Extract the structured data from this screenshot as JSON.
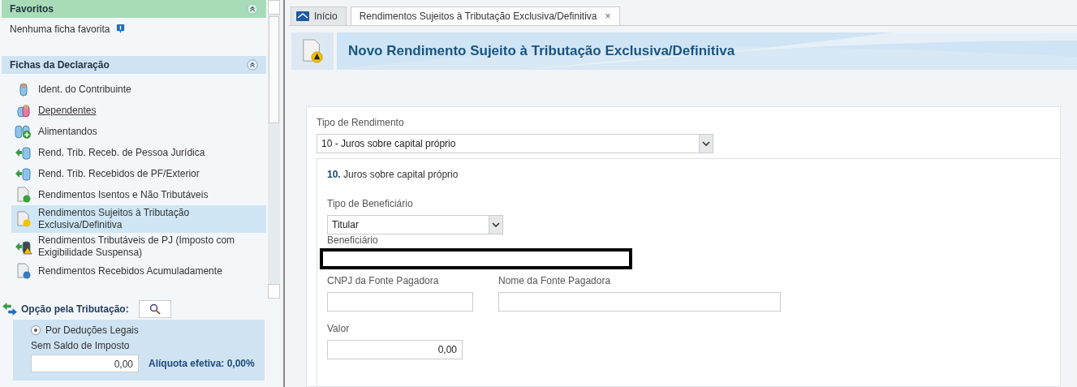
{
  "sidebar": {
    "favorites": {
      "title": "Favoritos",
      "expanded": true,
      "empty_text": "Nenhuma ficha favorita"
    },
    "sheets": {
      "title": "Fichas da Declaração",
      "expanded": true,
      "items": [
        {
          "label": "Ident. do Contribuinte",
          "kind": "person",
          "selected": false,
          "hovered": false
        },
        {
          "label": "Dependentes",
          "kind": "people",
          "selected": false,
          "hovered": true
        },
        {
          "label": "Alimentandos",
          "kind": "people-add",
          "selected": false,
          "hovered": false
        },
        {
          "label": "Rend. Trib. Receb. de Pessoa Jurídica",
          "kind": "arrow-person",
          "selected": false,
          "hovered": false
        },
        {
          "label": "Rend. Trib. Recebidos de PF/Exterior",
          "kind": "arrow-person",
          "selected": false,
          "hovered": false
        },
        {
          "label": "Rendimentos Isentos e Não Tributáveis",
          "kind": "doc-check",
          "selected": false,
          "hovered": false
        },
        {
          "label": "Rendimentos Sujeitos à Tributação Exclusiva/Definitiva",
          "kind": "doc-warning",
          "selected": true,
          "hovered": false
        },
        {
          "label": "Rendimentos Tributáveis de PJ (Imposto com Exigibilidade Suspensa)",
          "kind": "arrow-warning",
          "selected": false,
          "hovered": false
        },
        {
          "label": "Rendimentos Recebidos Acumuladamente",
          "kind": "doc-blue",
          "selected": false,
          "hovered": false
        }
      ]
    },
    "taxation": {
      "title": "Opção pela Tributação:",
      "option": {
        "label": "Por Deduções Legais",
        "selected": true
      },
      "balance_label": "Sem Saldo de Imposto",
      "balance_value": "0,00",
      "rate": "Alíquota efetiva: 0,00%"
    }
  },
  "tabs": [
    {
      "label": "Início",
      "selected": false
    },
    {
      "label": "Rendimentos Sujeitos à Tributação Exclusiva/Definitiva",
      "selected": true,
      "close": "×"
    }
  ],
  "page_title": "Novo Rendimento Sujeito à Tributação Exclusiva/Definitiva",
  "form": {
    "income_type": {
      "label": "Tipo de Rendimento",
      "value": "10 - Juros sobre capital próprio"
    },
    "section_title": "**10.** Juros sobre capital próprio",
    "beneficiary_type": {
      "label": "Tipo de Beneficiário",
      "value": "Titular"
    },
    "beneficiary": {
      "label": "Beneficiário"
    },
    "payer_cnpj": {
      "label": "CNPJ da Fonte Pagadora"
    },
    "payer_name": {
      "label": "Nome da Fonte Pagadora"
    },
    "amount": {
      "label": "Valor",
      "value": "0,00"
    }
  }
}
